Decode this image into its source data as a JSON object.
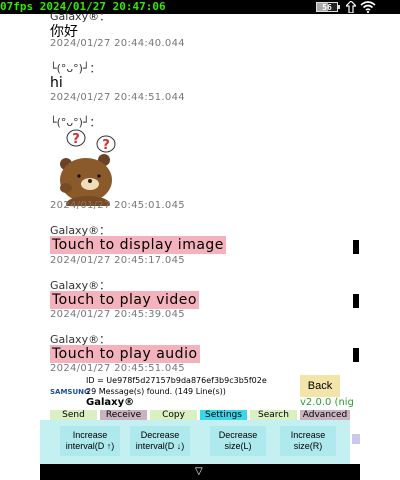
{
  "status_bar": {
    "text": "07fps 2024/01/27 20:47:06",
    "battery_level": "56",
    "battery_fraction": 0.56,
    "charge_icon": "charging-arrow-icon",
    "wifi_icon": "wifi-icon"
  },
  "messages": [
    {
      "sender": "Galaxy®：",
      "text": "你好",
      "time": "2024/01/27 20:44:40.044"
    },
    {
      "sender": "└(°ᴗ°)┘：",
      "text": "hi",
      "time": "2024/01/27 20:44:51.044"
    },
    {
      "sender": "└(°ᴗ°)┘：",
      "sticker": "bear-sticker-icon",
      "time": "2024/01/27 20:45:01.045"
    },
    {
      "sender": "Galaxy®：",
      "action": "Touch to display image",
      "time": "2024/01/27 20:45:17.045"
    },
    {
      "sender": "Galaxy®：",
      "action": "Touch to play video",
      "time": "2024/01/27 20:45:39.045"
    },
    {
      "sender": "Galaxy®：",
      "action": "Touch to play audio",
      "time": "2024/01/27 20:45:51.045"
    }
  ],
  "header": {
    "id_text": "ID = Ue978f5d27157b9da876ef3b9c3b5f02e",
    "brand": "SAMSUNG",
    "found_text": "29 Message(s) found. (149 Line(s))",
    "chat_name": "Galaxy®",
    "back_label": "Back",
    "version": "v2.0.0 (nig"
  },
  "tabs": [
    {
      "label": "Send",
      "color": "#d9f0c2"
    },
    {
      "label": "Receive",
      "color": "#c9b3bf"
    },
    {
      "label": "Copy",
      "color": "#d9f0c2"
    },
    {
      "label": "Settings",
      "color": "#3ad7e6"
    },
    {
      "label": "Search",
      "color": "#d9f0c2"
    },
    {
      "label": "Advanced",
      "color": "#c9b3bf"
    }
  ],
  "settings_buttons": [
    {
      "line1": "Increase",
      "line2": "interval(D ↑)"
    },
    {
      "line1": "Decrease",
      "line2": "interval(D ↓)"
    },
    {
      "line1": "Decrease",
      "line2": "size(L)"
    },
    {
      "line1": "Increase",
      "line2": "size(R)"
    }
  ],
  "nav": {
    "icon": "nav-down-triangle-icon",
    "glyph": "▽"
  }
}
